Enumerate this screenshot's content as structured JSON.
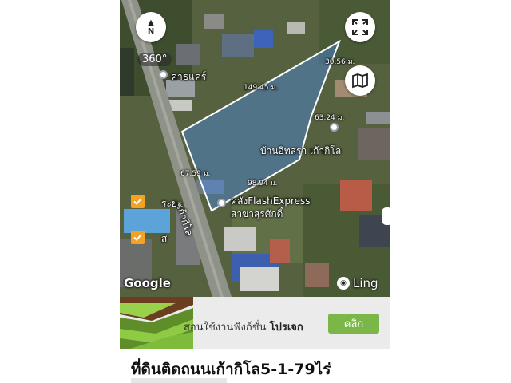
{
  "map": {
    "compass_label": "N",
    "badge_360": "360°",
    "attribution": "Google",
    "brand": "Ling",
    "brand_icon": "ling-owl-icon",
    "controls": [
      "compass-icon",
      "fullscreen-icon",
      "map-layers-icon"
    ],
    "measurements": {
      "top_right": "30.56 ม.",
      "top": "149.45 ม.",
      "right": "63.24 ม.",
      "left": "67.59 ม.",
      "bottom": "98.94 ม."
    },
    "places": {
      "petrol": "คาธแคร์",
      "landmark": "บ้านอิทสรา เก้ากิโล",
      "flash_line1": "คลังFlashExpress",
      "flash_line2": "สาขาสุรศักดิ์",
      "road": "เก้ากิโล",
      "rayong": "ระยะ",
      "side_s": "ส"
    },
    "polygon_color": "#4a90ff"
  },
  "promo": {
    "text_normal": "สอนใช้งานฟังก์ชั่น",
    "text_bold": "โปรเจก",
    "button_label": "คลิก",
    "button_color": "#7ab648"
  },
  "listing": {
    "title": "ที่ดินติดถนนเก้ากิโล5-1-79ไร่"
  }
}
